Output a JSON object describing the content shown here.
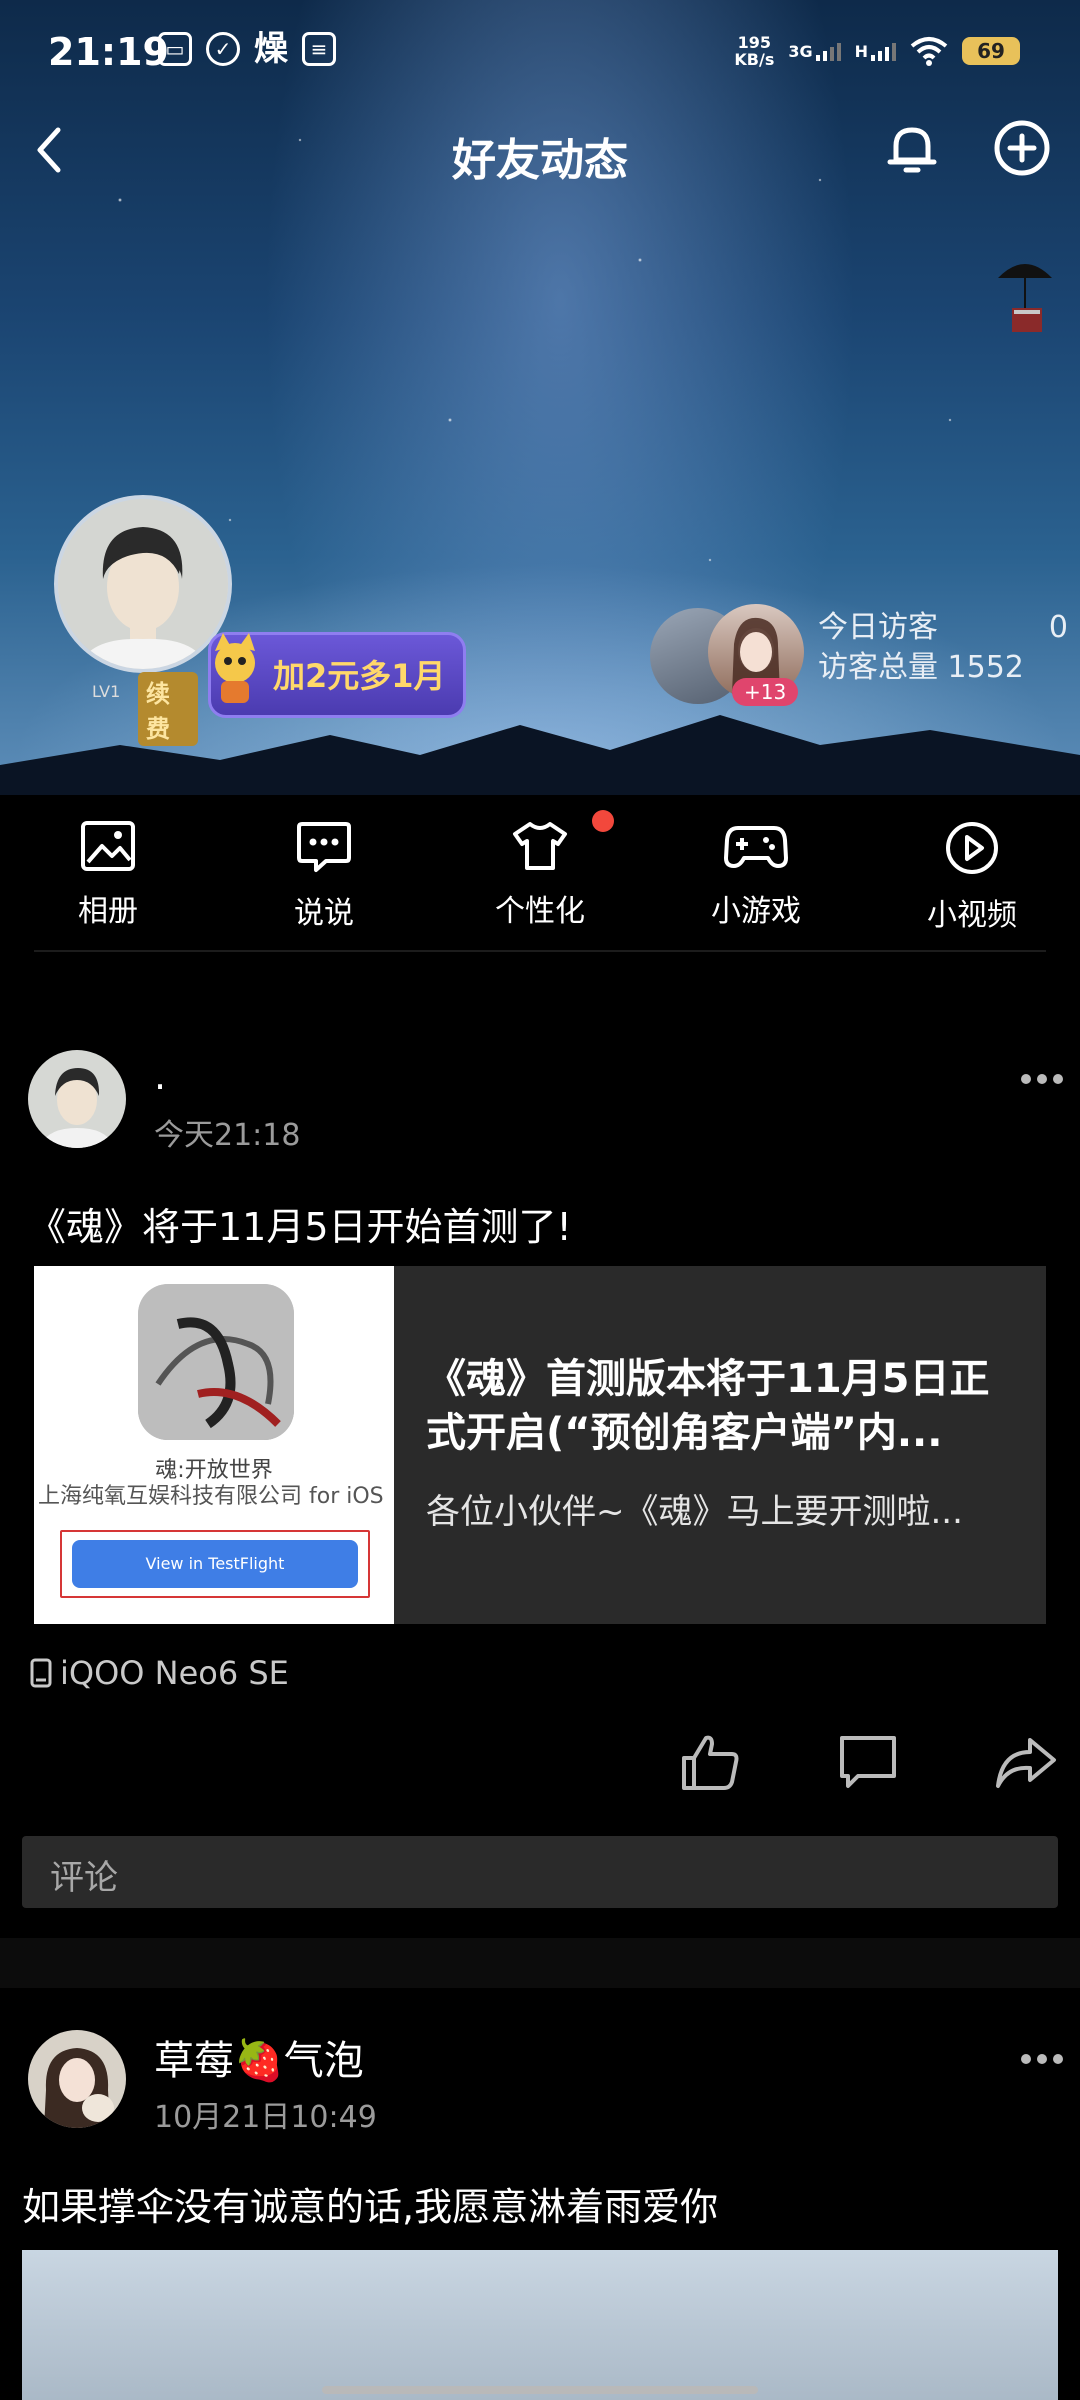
{
  "status_bar": {
    "time": "21:19",
    "net_speed": "195 KB/s",
    "net_speed_value": "195",
    "net_speed_unit": "KB/s",
    "network_3g": "3G",
    "network_h": "H",
    "battery": "69",
    "weather_char": "燥"
  },
  "nav": {
    "title": "好友动态"
  },
  "profile": {
    "level": "LV1",
    "renew_label": "续费",
    "vip_promo": "加2元多1月",
    "visitor_extra_count": "+13",
    "today_visitors_label": "今日访客",
    "today_visitors_value": "0",
    "total_visitors_label": "访客总量",
    "total_visitors_value": "1552"
  },
  "shortcuts": [
    {
      "label": "相册",
      "icon": "photo-album-icon"
    },
    {
      "label": "说说",
      "icon": "chat-bubble-icon"
    },
    {
      "label": "个性化",
      "icon": "tshirt-icon"
    },
    {
      "label": "小游戏",
      "icon": "gamepad-icon"
    },
    {
      "label": "小视频",
      "icon": "play-circle-icon"
    }
  ],
  "posts": [
    {
      "author": ".",
      "time": "今天21:18",
      "text": "《魂》将于11月5日开始首测了!",
      "share": {
        "thumb_app_name": "魂:开放世界",
        "thumb_developer": "上海纯氧互娱科技有限公司 for iOS",
        "thumb_button": "View in TestFlight",
        "title": "《魂》首测版本将于11月5日正式开启(“预创角客户端”内...",
        "desc": "各位小伙伴~《魂》马上要开测啦..."
      },
      "device": "iQOO Neo6 SE",
      "comment_placeholder": "评论"
    },
    {
      "author": "草莓🍓气泡",
      "time": "10月21日10:49",
      "text": "如果撑伞没有诚意的话,我愿意淋着雨爱你"
    }
  ],
  "colors": {
    "background": "#000000",
    "card_bg": "#2a2a2a",
    "notification_dot": "#f2483c",
    "vip_purple": "#5a48c8",
    "visitor_badge": "#e0456d"
  }
}
